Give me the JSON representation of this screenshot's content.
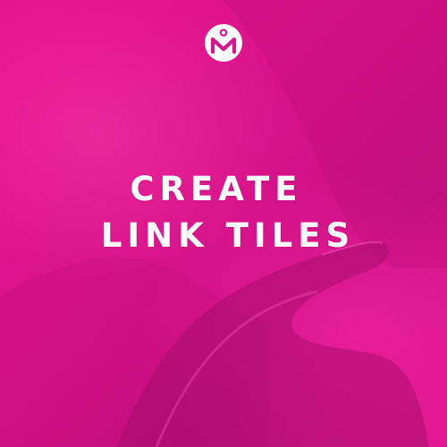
{
  "headline": {
    "line1": "CREATE",
    "line2": "LINK TILES"
  },
  "colors": {
    "background": "#e0168e",
    "logo_circle": "#ffffff",
    "logo_mark": "#d9138a",
    "headline_text": "#ffffff"
  },
  "icons": {
    "logo": "brand-logo-icon"
  }
}
